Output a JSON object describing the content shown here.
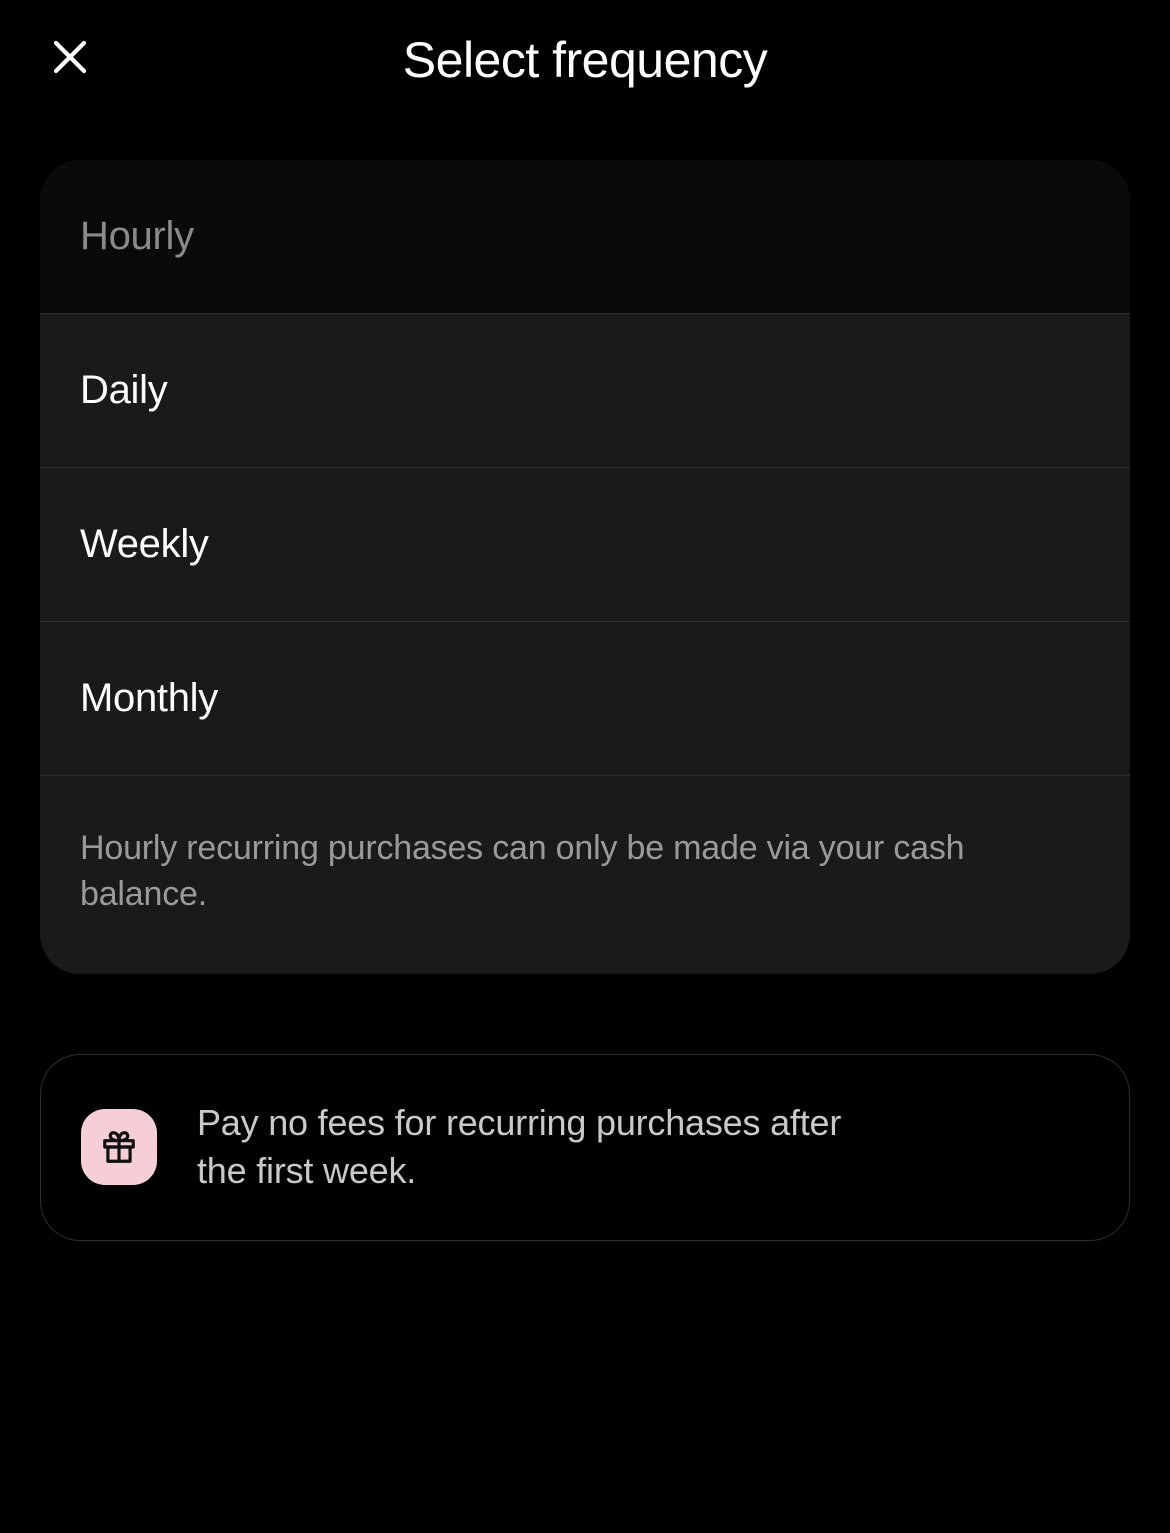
{
  "header": {
    "title": "Select frequency"
  },
  "frequency": {
    "options": [
      {
        "label": "Hourly",
        "selected": true
      },
      {
        "label": "Daily",
        "selected": false
      },
      {
        "label": "Weekly",
        "selected": false
      },
      {
        "label": "Monthly",
        "selected": false
      }
    ],
    "hint": "Hourly recurring purchases can only be made via your cash balance."
  },
  "promo": {
    "text": "Pay no fees for recurring purchases after the first week.",
    "icon": "gift-icon",
    "badge_color": "#f6cfd6"
  }
}
